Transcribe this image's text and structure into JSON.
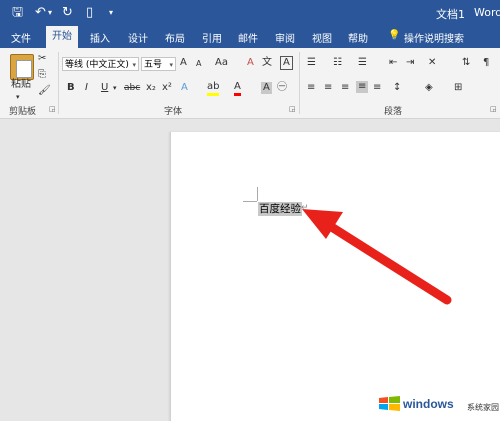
{
  "titlebar": {
    "doc_title": "文档1",
    "app_name": "Word"
  },
  "tabs": [
    "文件",
    "开始",
    "插入",
    "设计",
    "布局",
    "引用",
    "邮件",
    "审阅",
    "视图",
    "帮助"
  ],
  "tell_me": "操作说明搜索",
  "active_tab": "开始",
  "clipboard": {
    "paste_label": "粘贴",
    "group_label": "剪贴板"
  },
  "font": {
    "font_name": "等线 (中文正文)",
    "font_size": "五号",
    "grow_label": "A",
    "shrink_label": "A",
    "case_label": "Aa",
    "clear_format_label": "A",
    "char_border_label": "A",
    "bold": "B",
    "italic": "I",
    "underline": "U",
    "strike": "abc",
    "subscript": "x₂",
    "superscript": "x²",
    "text_effects": "A",
    "highlight": "ab",
    "font_color": "A",
    "char_shading": "A",
    "group_label": "字体"
  },
  "paragraph": {
    "group_label": "段落"
  },
  "document": {
    "text": "百度经验",
    "para_mark": "↵"
  },
  "watermark": {
    "brand": "windows",
    "sub": "系统家园"
  },
  "colors": {
    "title_blue": "#2b579a",
    "arrow_red": "#e8221a",
    "highlight_yellow": "#ffff00",
    "font_red": "#ff0000"
  }
}
